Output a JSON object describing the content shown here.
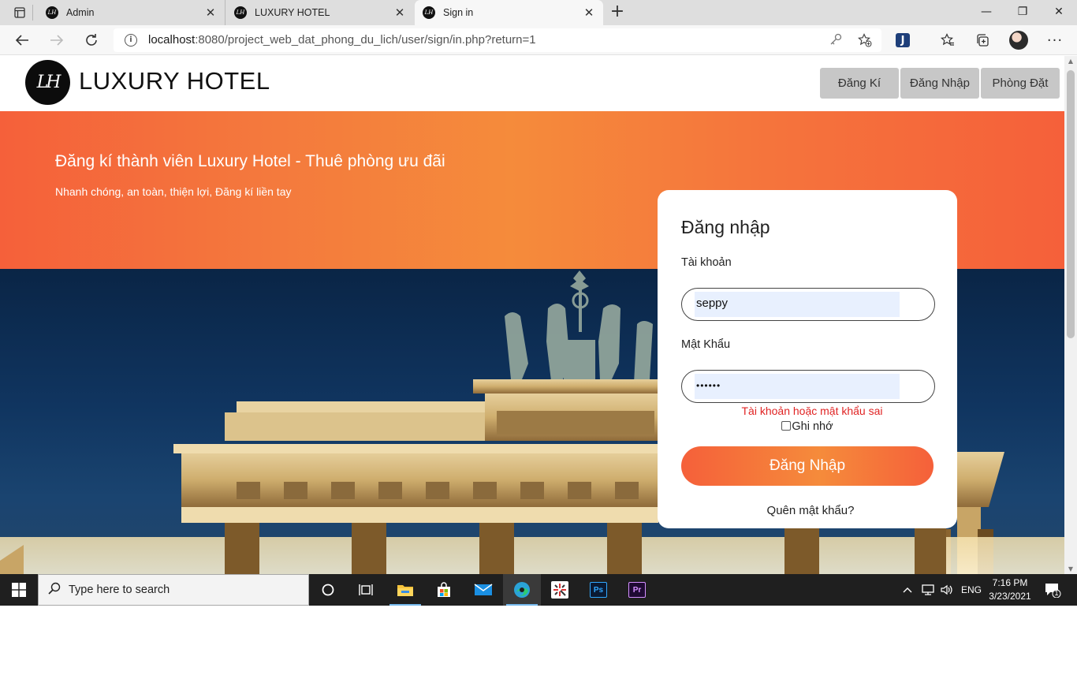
{
  "browser": {
    "tabs": [
      {
        "title": "Admin",
        "close": "✕"
      },
      {
        "title": "LUXURY HOTEL",
        "close": "✕"
      },
      {
        "title": "Sign in",
        "close": "✕"
      }
    ],
    "new_tab": "+",
    "url_host": "localhost",
    "url_rest": ":8080/project_web_dat_phong_du_lich/user/sign/in.php?return=1",
    "window": {
      "minimize": "—",
      "restore": "❐",
      "close": "✕"
    },
    "icons": [
      "tab-actions-icon",
      "back-icon",
      "forward-icon",
      "refresh-icon",
      "info-icon",
      "key-icon",
      "add-favorite-icon",
      "extension-icon",
      "favorites-icon",
      "collections-icon",
      "profile-icon",
      "more-icon"
    ]
  },
  "site": {
    "logo_mark": "LH",
    "brand": "LUXURY HOTEL",
    "nav": {
      "register": "Đăng Kí",
      "login": "Đăng Nhập",
      "booking": "Phòng Đặt"
    },
    "hero_title": "Đăng kí thành viên Luxury Hotel - Thuê phòng ưu đãi",
    "hero_subtitle": "Nhanh chóng, an toàn, thiện lợi, Đăng kí liền tay"
  },
  "login": {
    "title": "Đăng nhập",
    "username_label": "Tài khoản",
    "username_value": "seppy",
    "password_label": "Mật Khẩu",
    "password_value": "••••••",
    "error": "Tài khoản hoặc mật khẩu sai",
    "remember": "Ghi nhớ",
    "submit": "Đăng Nhập",
    "forgot": "Quên mật khẩu?"
  },
  "taskbar": {
    "search_placeholder": "Type here to search",
    "lang": "ENG",
    "time": "7:16 PM",
    "date": "3/23/2021",
    "notifications": "1",
    "apps": [
      "cortana-icon",
      "task-view-icon",
      "file-explorer-icon",
      "store-icon",
      "mail-icon",
      "edge-icon",
      "snip-icon",
      "photoshop-icon",
      "premiere-icon"
    ],
    "ps_label": "Ps",
    "pr_label": "Pr"
  },
  "colors": {
    "accent_orange": "#f5603a",
    "accent_orange_mid": "#f58b3b",
    "error_red": "#e02323"
  }
}
